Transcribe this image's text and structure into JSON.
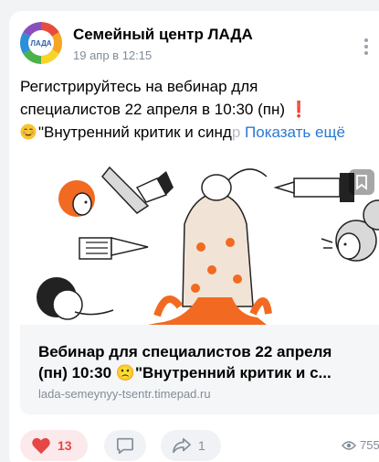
{
  "header": {
    "group_name": "Семейный центр ЛАДА",
    "post_time": "19 апр в 12:15",
    "avatar_text": "ЛАДА"
  },
  "post": {
    "line1": "Регистрируйтесь на вебинар для",
    "line2": "специалистов 22 апреля в 10:30 (пн)",
    "line2_emoji": "❗",
    "line3_text": "\"Внутренний критик и синд",
    "line3_tail": "р",
    "show_more": "Показать ещё"
  },
  "attachment": {
    "title_line1": "Вебинар для специалистов 22 апреля",
    "title_line2": "(пн) 10:30 🙁\"Внутренний критик и с...",
    "link": "lada-semeynyy-tsentr.timepad.ru"
  },
  "actions": {
    "likes": "13",
    "shares": "1",
    "views": "755"
  },
  "colors": {
    "accent": "#2a78d4",
    "like": "#e64646",
    "illustration_orange": "#f26a21"
  }
}
